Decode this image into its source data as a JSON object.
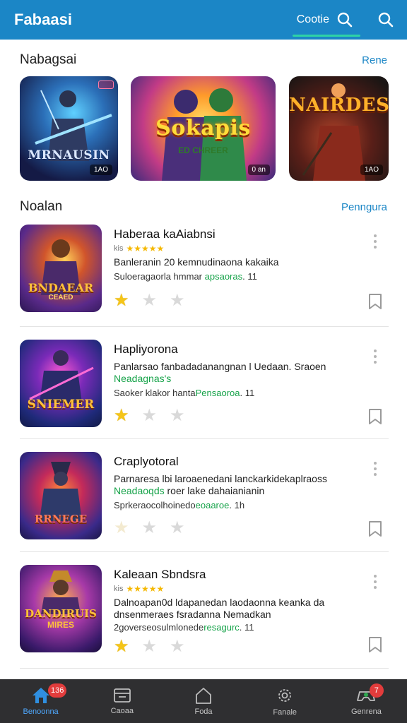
{
  "app": {
    "title": "Fabaasi"
  },
  "topbar": {
    "search_label": "Cootie"
  },
  "featured_section": {
    "title": "Nabagsai",
    "link": "Rene",
    "cards": [
      {
        "title": "MRNAUSIN",
        "badge": "1AO"
      },
      {
        "title": "Sokapis",
        "subtitle": "ED CHREER",
        "badge": "0 an"
      },
      {
        "title": "NAIRDES",
        "badge": "1AO"
      }
    ]
  },
  "list_section": {
    "title": "Noalan",
    "link": "Penngura",
    "items": [
      {
        "title": "Haberaa kaAiabnsi",
        "rating_prefix": "kis",
        "stars": "★★★★★",
        "line1": "Banleranin 20 kemnudinaona kakaika",
        "meta_prefix": "Suloeragaorla hmmar ",
        "meta_green": "apsaoras",
        "meta_suffix": ". 11",
        "thumb_title": "BNDAEAR",
        "thumb_sub": "CEAED"
      },
      {
        "title": "Hapliyorona",
        "line1": "Panlarsao fanbadadanangnan l Uedaan. Sraoen",
        "line_green": "Neadagnas's",
        "meta_prefix": "Saoker klakor hanta",
        "meta_green": "Pensaoroa",
        "meta_suffix": ". 11",
        "thumb_title": "SNIEMER",
        "thumb_sub": ""
      },
      {
        "title": "Craplyotoral",
        "line1": "Parnaresa lbi laroaenedani lanckarkidekaplraoss",
        "line_green": "Neadaoqds",
        "line_after_green": " roer lake dahaianianin",
        "meta_prefix": "Sprkeraocolhoinedo",
        "meta_green": "eoaaroe",
        "meta_suffix": ". 1h",
        "thumb_title": "RRNEGE",
        "thumb_sub": ""
      },
      {
        "title": "Kaleaan Sbndsra",
        "rating_prefix": "kis",
        "stars": "★★★★★",
        "line1": "Dalnoapan0d ldapanedan laodaonna keanka da",
        "line2": "dnsenmeraes fsradanna Nemadkan",
        "meta_prefix": "2goverseosulmlonede",
        "meta_green": "resagurc",
        "meta_suffix": ". 11",
        "thumb_title": "DANDIRUIS",
        "thumb_sub": "MIRES"
      }
    ]
  },
  "bottom_nav": {
    "items": [
      {
        "label": "Benoonna",
        "badge": "136"
      },
      {
        "label": "Caoaa"
      },
      {
        "label": "Foda"
      },
      {
        "label": "Fanale"
      },
      {
        "label": "Genrena",
        "badge": "7"
      }
    ]
  },
  "colors": {
    "primary": "#1b86c6",
    "accent": "#2fd3a5",
    "green_text": "#17a34a",
    "nav_bg": "#2f2f31"
  }
}
